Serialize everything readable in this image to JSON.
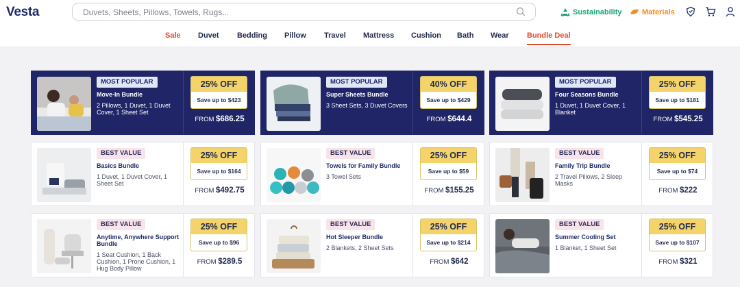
{
  "header": {
    "logo": "Vesta",
    "search_placeholder": "Duvets, Sheets, Pillows, Towels, Rugs...",
    "sustainability": "Sustainability",
    "materials": "Materials",
    "colors": {
      "sustainability": "#1aa37a",
      "materials": "#f28a1e",
      "sale": "#e04b2c"
    }
  },
  "nav": [
    "Sale",
    "Duvet",
    "Bedding",
    "Pillow",
    "Travel",
    "Mattress",
    "Cushion",
    "Bath",
    "Wear",
    "Bundle Deal"
  ],
  "cards": [
    {
      "badge": "MOST POPULAR",
      "title": "Move-In Bundle",
      "desc": "2 Pillows, 1 Duvet, 1 Duvet Cover, 1 Sheet Set",
      "off": "25% OFF",
      "save": "Save up to $423",
      "from_label": "FROM",
      "price": "$686.25",
      "image": "woman-child-bed-photo"
    },
    {
      "badge": "MOST POPULAR",
      "title": "Super Sheets Bundle",
      "desc": "3 Sheet Sets, 3 Duvet Covers",
      "off": "40% OFF",
      "save": "Save up to $429",
      "from_label": "FROM",
      "price": "$644.4",
      "image": "sheets-folded-photo"
    },
    {
      "badge": "MOST POPULAR",
      "title": "Four Seasons Bundle",
      "desc": "1 Duvet, 1 Duvet Cover, 1 Blanket",
      "off": "25% OFF",
      "save": "Save up to $181",
      "from_label": "FROM",
      "price": "$545.25",
      "image": "duvet-stack-photo"
    },
    {
      "badge": "BEST VALUE",
      "title": "Basics Bundle",
      "desc": "1 Duvet, 1 Duvet Cover, 1 Sheet Set",
      "off": "25% OFF",
      "save": "Save up to $164",
      "from_label": "FROM",
      "price": "$492.75",
      "image": "basics-products-photo"
    },
    {
      "badge": "BEST VALUE",
      "title": "Towels for Family Bundle",
      "desc": "3 Towel Sets",
      "off": "25% OFF",
      "save": "Save up to $59",
      "from_label": "FROM",
      "price": "$155.25",
      "image": "rolled-towels-photo"
    },
    {
      "badge": "BEST VALUE",
      "title": "Family Trip Bundle",
      "desc": "2 Travel Pillows, 2 Sleep Masks",
      "off": "25% OFF",
      "save": "Save up to $74",
      "from_label": "FROM",
      "price": "$222",
      "image": "traveller-luggage-photo"
    },
    {
      "badge": "BEST VALUE",
      "title": "Anytime, Anywhere Support Bundle",
      "desc": "1 Seat Cushion, 1 Back Cushion, 1 Prone Cushion, 1 Hug Body Pillow",
      "off": "25% OFF",
      "save": "Save up to $96",
      "from_label": "FROM",
      "price": "$289.5",
      "image": "cushions-chair-photo"
    },
    {
      "badge": "BEST VALUE",
      "title": "Hot Sleeper Bundle",
      "desc": "2 Blankets, 2 Sheet Sets",
      "off": "25% OFF",
      "save": "Save up to $214",
      "from_label": "FROM",
      "price": "$642",
      "image": "blankets-basket-photo"
    },
    {
      "badge": "BEST VALUE",
      "title": "Summer Cooling Set",
      "desc": "1 Blanket, 1 Sheet Set",
      "off": "25% OFF",
      "save": "Save up to $107",
      "from_label": "FROM",
      "price": "$321",
      "image": "woman-sleeping-photo"
    }
  ]
}
